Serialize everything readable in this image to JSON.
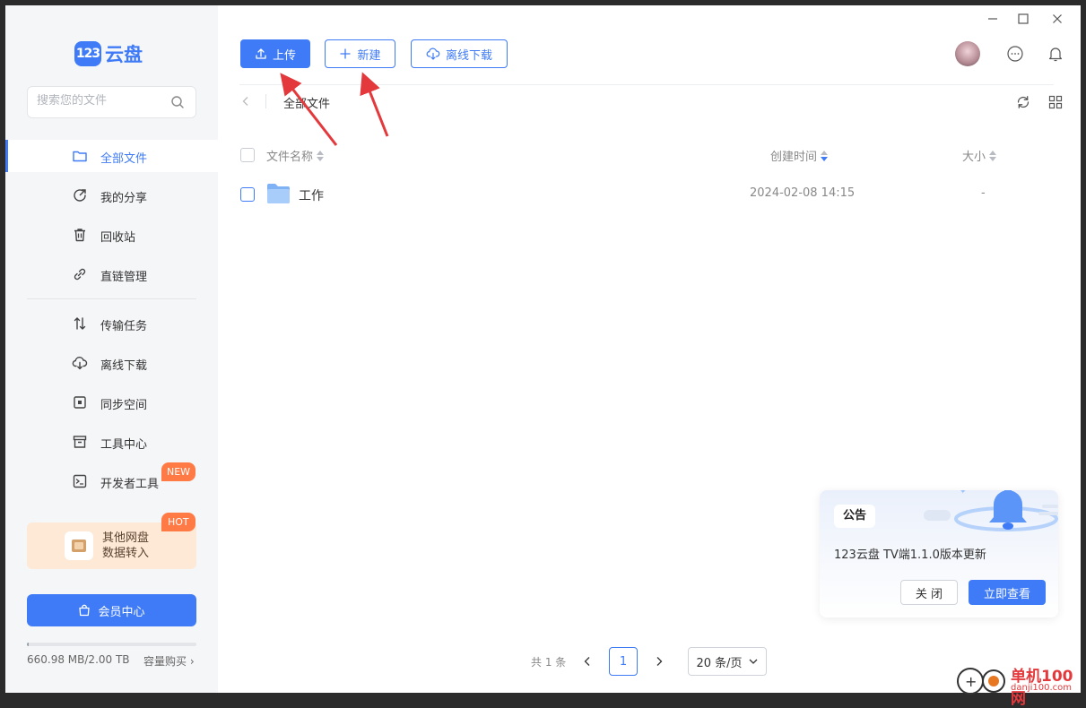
{
  "app": {
    "logo_mark": "123",
    "logo_text": "云盘"
  },
  "search": {
    "placeholder": "搜索您的文件"
  },
  "sidebar": {
    "items": [
      {
        "label": "全部文件",
        "active": true,
        "icon": "folder-icon"
      },
      {
        "label": "我的分享",
        "icon": "share-icon"
      },
      {
        "label": "回收站",
        "icon": "trash-icon"
      },
      {
        "label": "直链管理",
        "icon": "link-icon"
      },
      {
        "label": "传输任务",
        "icon": "transfer-icon"
      },
      {
        "label": "离线下载",
        "icon": "cloud-download-icon"
      },
      {
        "label": "同步空间",
        "icon": "sync-icon"
      },
      {
        "label": "工具中心",
        "icon": "toolbox-icon"
      },
      {
        "label": "开发者工具",
        "icon": "terminal-icon"
      }
    ],
    "new_badge": "NEW",
    "hot_badge": "HOT",
    "transfer_card": {
      "line1": "其他网盘",
      "line2": "数据转入"
    },
    "vip_button": "会员中心",
    "storage": {
      "text": "660.98 MB/2.00 TB",
      "used_fraction": 0.0003
    },
    "buy_link": "容量购买"
  },
  "toolbar": {
    "upload": "上传",
    "create": "新建",
    "offline_download": "离线下载"
  },
  "breadcrumb": {
    "current": "全部文件"
  },
  "table": {
    "headers": {
      "name": "文件名称",
      "created": "创建时间",
      "size": "大小"
    },
    "rows": [
      {
        "name": "工作",
        "created": "2024-02-08 14:15",
        "size": "-",
        "type": "folder"
      }
    ]
  },
  "notice": {
    "tag": "公告",
    "text": "123云盘 TV端1.1.0版本更新",
    "close": "关 闭",
    "view": "立即查看"
  },
  "pagination": {
    "total": "共 1 条",
    "current_page": "1",
    "page_size": "20 条/页"
  },
  "watermark": {
    "title": "单机100网",
    "sub": "danji100.com"
  },
  "colors": {
    "accent": "#3f7bf6",
    "badge": "#ff7a45",
    "annotation": "#e4393c"
  }
}
